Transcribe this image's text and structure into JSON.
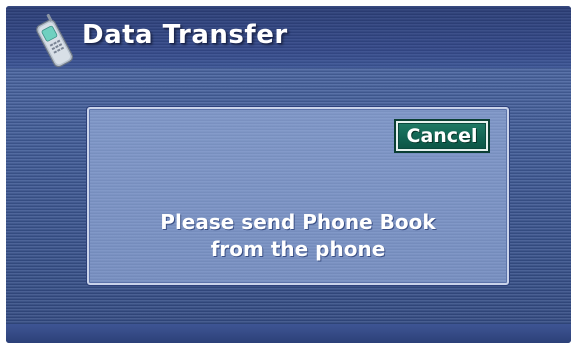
{
  "header": {
    "title": "Data Transfer",
    "icon": "mobile-phone-icon"
  },
  "dialog": {
    "cancel_label": "Cancel",
    "message_line1": "Please send Phone Book",
    "message_line2": "from the phone"
  },
  "colors": {
    "background": "#3f5a96",
    "dialog": "#7890c2",
    "cancel_button": "#116352",
    "text": "#ffffff"
  }
}
